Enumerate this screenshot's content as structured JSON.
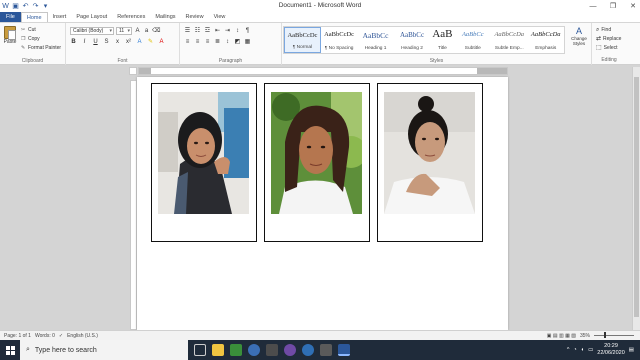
{
  "window": {
    "title": "Document1 - Microsoft Word",
    "min": "—",
    "restore": "❐",
    "close": "✕"
  },
  "tabs": [
    "File",
    "Home",
    "Insert",
    "Page Layout",
    "References",
    "Mailings",
    "Review",
    "View"
  ],
  "ribbon": {
    "clipboard": {
      "paste": "Paste",
      "cut": "Cut",
      "copy": "Copy",
      "format_painter": "Format Painter",
      "label": "Clipboard"
    },
    "font": {
      "family": "Calibri (Body)",
      "size": "11",
      "label": "Font"
    },
    "paragraph": {
      "label": "Paragraph"
    },
    "styles": {
      "items": [
        {
          "sample": "AaBbCcDc",
          "name": "¶ Normal"
        },
        {
          "sample": "AaBbCcDc",
          "name": "¶ No Spacing"
        },
        {
          "sample": "AaBbCc",
          "name": "Heading 1"
        },
        {
          "sample": "AaBbCc",
          "name": "Heading 2"
        },
        {
          "sample": "AaB",
          "name": "Title"
        },
        {
          "sample": "AaBbCc",
          "name": "Subtitle"
        },
        {
          "sample": "AaBbCcDa",
          "name": "Subtle Emp..."
        },
        {
          "sample": "AaBbCcDa",
          "name": "Emphasis"
        }
      ],
      "change_styles": "Change Styles",
      "label": "Styles"
    },
    "editing": {
      "find": "Find",
      "replace": "Replace",
      "select": "Select",
      "label": "Editing"
    }
  },
  "statusbar": {
    "page": "Page: 1 of 1",
    "words": "Words: 0",
    "language": "English (U.S.)",
    "zoom": "35%"
  },
  "taskbar": {
    "search_placeholder": "Type here to search",
    "time": "20:29",
    "date": "22/06/2020"
  },
  "colors": {
    "word_blue": "#2b579a",
    "taskbar": "#1f2b3a"
  }
}
